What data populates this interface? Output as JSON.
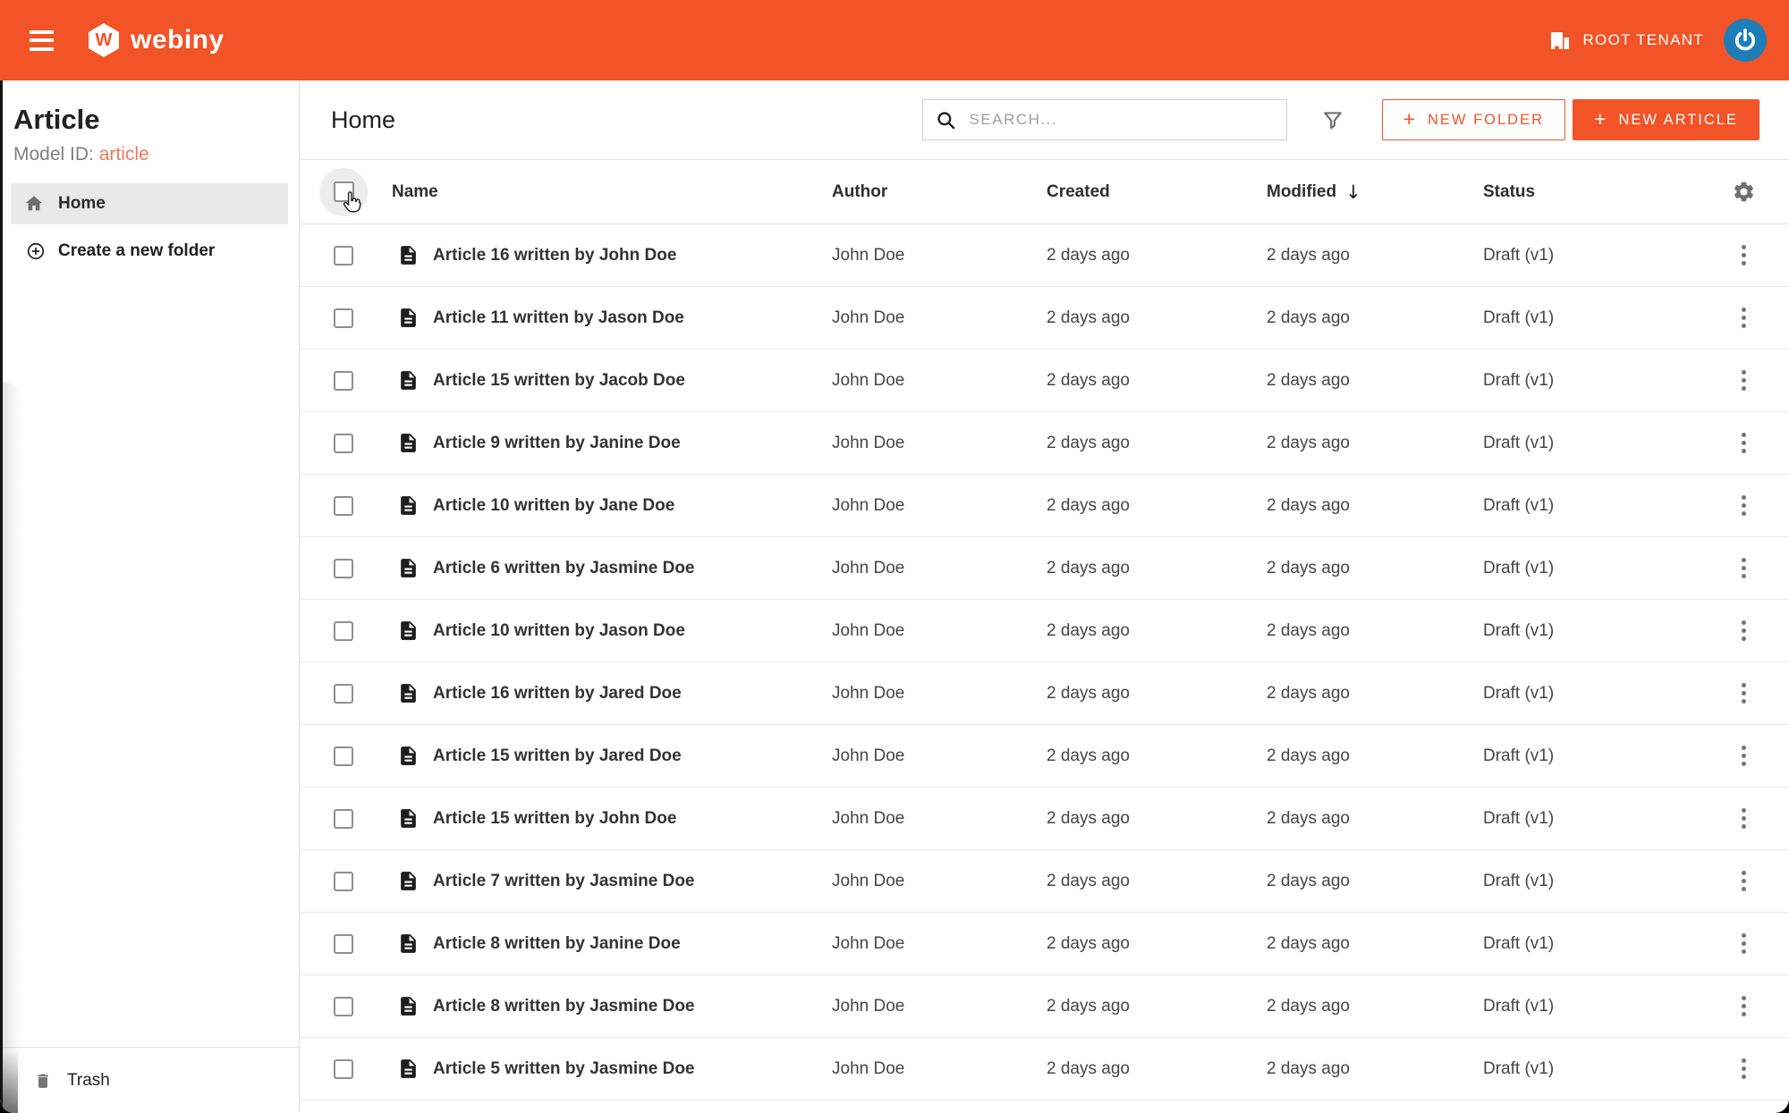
{
  "appbar": {
    "brand": "webiny",
    "brand_letter": "W",
    "tenant_label": "ROOT TENANT"
  },
  "sidebar": {
    "title": "Article",
    "model_id_label": "Model ID:",
    "model_id_value": "article",
    "home_label": "Home",
    "create_folder_label": "Create a new folder",
    "trash_label": "Trash"
  },
  "main": {
    "title": "Home",
    "search_placeholder": "SEARCH...",
    "new_folder_label": "NEW FOLDER",
    "new_article_label": "NEW ARTICLE"
  },
  "icons": {
    "plus": "+",
    "sort_desc": "↓"
  },
  "table": {
    "columns": [
      "Name",
      "Author",
      "Created",
      "Modified",
      "Status"
    ],
    "sort_column": "Modified",
    "sort_direction": "desc",
    "rows": [
      {
        "name": "Article 16 written by John Doe",
        "author": "John Doe",
        "created": "2 days ago",
        "modified": "2 days ago",
        "status": "Draft (v1)"
      },
      {
        "name": "Article 11 written by Jason Doe",
        "author": "John Doe",
        "created": "2 days ago",
        "modified": "2 days ago",
        "status": "Draft (v1)"
      },
      {
        "name": "Article 15 written by Jacob Doe",
        "author": "John Doe",
        "created": "2 days ago",
        "modified": "2 days ago",
        "status": "Draft (v1)"
      },
      {
        "name": "Article 9 written by Janine Doe",
        "author": "John Doe",
        "created": "2 days ago",
        "modified": "2 days ago",
        "status": "Draft (v1)"
      },
      {
        "name": "Article 10 written by Jane Doe",
        "author": "John Doe",
        "created": "2 days ago",
        "modified": "2 days ago",
        "status": "Draft (v1)"
      },
      {
        "name": "Article 6 written by Jasmine Doe",
        "author": "John Doe",
        "created": "2 days ago",
        "modified": "2 days ago",
        "status": "Draft (v1)"
      },
      {
        "name": "Article 10 written by Jason Doe",
        "author": "John Doe",
        "created": "2 days ago",
        "modified": "2 days ago",
        "status": "Draft (v1)"
      },
      {
        "name": "Article 16 written by Jared Doe",
        "author": "John Doe",
        "created": "2 days ago",
        "modified": "2 days ago",
        "status": "Draft (v1)"
      },
      {
        "name": "Article 15 written by Jared Doe",
        "author": "John Doe",
        "created": "2 days ago",
        "modified": "2 days ago",
        "status": "Draft (v1)"
      },
      {
        "name": "Article 15 written by John Doe",
        "author": "John Doe",
        "created": "2 days ago",
        "modified": "2 days ago",
        "status": "Draft (v1)"
      },
      {
        "name": "Article 7 written by Jasmine Doe",
        "author": "John Doe",
        "created": "2 days ago",
        "modified": "2 days ago",
        "status": "Draft (v1)"
      },
      {
        "name": "Article 8 written by Janine Doe",
        "author": "John Doe",
        "created": "2 days ago",
        "modified": "2 days ago",
        "status": "Draft (v1)"
      },
      {
        "name": "Article 8 written by Jasmine Doe",
        "author": "John Doe",
        "created": "2 days ago",
        "modified": "2 days ago",
        "status": "Draft (v1)"
      },
      {
        "name": "Article 5 written by Jasmine Doe",
        "author": "John Doe",
        "created": "2 days ago",
        "modified": "2 days ago",
        "status": "Draft (v1)"
      }
    ]
  },
  "colors": {
    "primary": "#f25327",
    "model_id_accent": "#ee7a5c",
    "avatar_bg": "#1d7db9",
    "selected_nav_bg": "#e9e9e9",
    "row_divider": "#e9e9e9",
    "muted_icon": "#6f6f6f"
  }
}
